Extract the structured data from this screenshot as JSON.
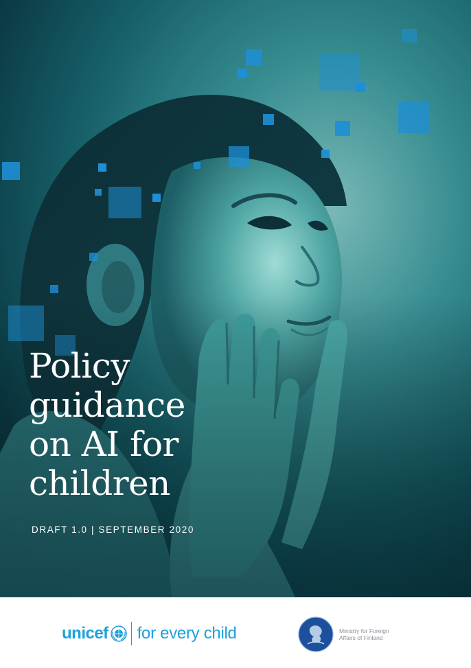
{
  "cover": {
    "title": "Policy\nguidance\non AI for\nchildren",
    "subtitle": "DRAFT 1.0 | SEPTEMBER 2020"
  },
  "footer": {
    "unicef": {
      "name": "unicef",
      "tagline": "for every child",
      "color": "#1ca0dc"
    },
    "ministry": {
      "name": "Ministry for Foreign Affairs of Finland",
      "seal_color": "#1c4f9c"
    }
  },
  "colors": {
    "hero_dark": "#072a33",
    "hero_mid": "#1a6a72",
    "hero_light": "#8fd3cf",
    "pixel_accent": "#1e8fd6"
  },
  "icons": {
    "unicef_emblem": "globe-wreath-icon",
    "ministry_seal": "lion-coat-of-arms-icon"
  }
}
